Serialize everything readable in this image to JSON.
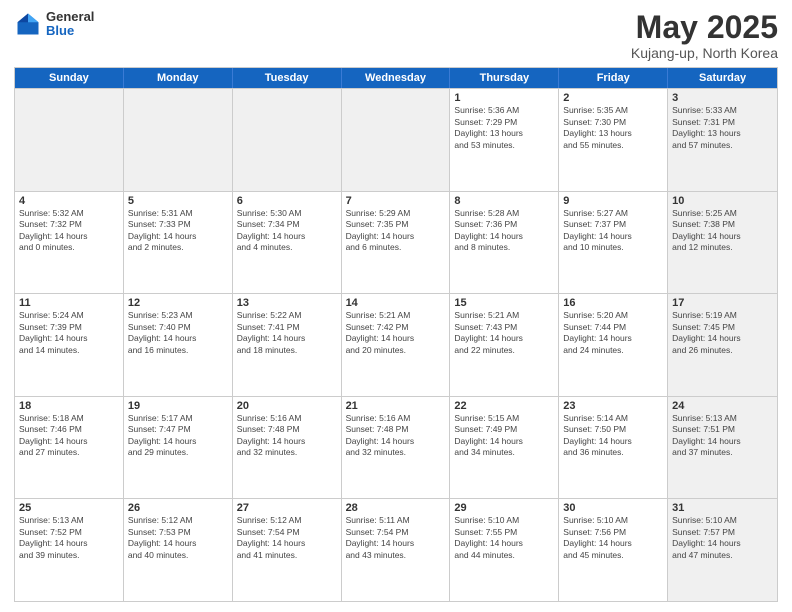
{
  "logo": {
    "general": "General",
    "blue": "Blue"
  },
  "title": "May 2025",
  "subtitle": "Kujang-up, North Korea",
  "days": [
    "Sunday",
    "Monday",
    "Tuesday",
    "Wednesday",
    "Thursday",
    "Friday",
    "Saturday"
  ],
  "rows": [
    [
      {
        "day": "",
        "sunrise": "",
        "sunset": "",
        "daylight": "",
        "shaded": true
      },
      {
        "day": "",
        "sunrise": "",
        "sunset": "",
        "daylight": "",
        "shaded": true
      },
      {
        "day": "",
        "sunrise": "",
        "sunset": "",
        "daylight": "",
        "shaded": true
      },
      {
        "day": "",
        "sunrise": "",
        "sunset": "",
        "daylight": "",
        "shaded": true
      },
      {
        "day": "1",
        "sunrise": "Sunrise: 5:36 AM",
        "sunset": "Sunset: 7:29 PM",
        "daylight": "Daylight: 13 hours",
        "daylight2": "and 53 minutes."
      },
      {
        "day": "2",
        "sunrise": "Sunrise: 5:35 AM",
        "sunset": "Sunset: 7:30 PM",
        "daylight": "Daylight: 13 hours",
        "daylight2": "and 55 minutes."
      },
      {
        "day": "3",
        "sunrise": "Sunrise: 5:33 AM",
        "sunset": "Sunset: 7:31 PM",
        "daylight": "Daylight: 13 hours",
        "daylight2": "and 57 minutes.",
        "shaded": true
      }
    ],
    [
      {
        "day": "4",
        "sunrise": "Sunrise: 5:32 AM",
        "sunset": "Sunset: 7:32 PM",
        "daylight": "Daylight: 14 hours",
        "daylight2": "and 0 minutes."
      },
      {
        "day": "5",
        "sunrise": "Sunrise: 5:31 AM",
        "sunset": "Sunset: 7:33 PM",
        "daylight": "Daylight: 14 hours",
        "daylight2": "and 2 minutes."
      },
      {
        "day": "6",
        "sunrise": "Sunrise: 5:30 AM",
        "sunset": "Sunset: 7:34 PM",
        "daylight": "Daylight: 14 hours",
        "daylight2": "and 4 minutes."
      },
      {
        "day": "7",
        "sunrise": "Sunrise: 5:29 AM",
        "sunset": "Sunset: 7:35 PM",
        "daylight": "Daylight: 14 hours",
        "daylight2": "and 6 minutes."
      },
      {
        "day": "8",
        "sunrise": "Sunrise: 5:28 AM",
        "sunset": "Sunset: 7:36 PM",
        "daylight": "Daylight: 14 hours",
        "daylight2": "and 8 minutes."
      },
      {
        "day": "9",
        "sunrise": "Sunrise: 5:27 AM",
        "sunset": "Sunset: 7:37 PM",
        "daylight": "Daylight: 14 hours",
        "daylight2": "and 10 minutes."
      },
      {
        "day": "10",
        "sunrise": "Sunrise: 5:25 AM",
        "sunset": "Sunset: 7:38 PM",
        "daylight": "Daylight: 14 hours",
        "daylight2": "and 12 minutes.",
        "shaded": true
      }
    ],
    [
      {
        "day": "11",
        "sunrise": "Sunrise: 5:24 AM",
        "sunset": "Sunset: 7:39 PM",
        "daylight": "Daylight: 14 hours",
        "daylight2": "and 14 minutes."
      },
      {
        "day": "12",
        "sunrise": "Sunrise: 5:23 AM",
        "sunset": "Sunset: 7:40 PM",
        "daylight": "Daylight: 14 hours",
        "daylight2": "and 16 minutes."
      },
      {
        "day": "13",
        "sunrise": "Sunrise: 5:22 AM",
        "sunset": "Sunset: 7:41 PM",
        "daylight": "Daylight: 14 hours",
        "daylight2": "and 18 minutes."
      },
      {
        "day": "14",
        "sunrise": "Sunrise: 5:21 AM",
        "sunset": "Sunset: 7:42 PM",
        "daylight": "Daylight: 14 hours",
        "daylight2": "and 20 minutes."
      },
      {
        "day": "15",
        "sunrise": "Sunrise: 5:21 AM",
        "sunset": "Sunset: 7:43 PM",
        "daylight": "Daylight: 14 hours",
        "daylight2": "and 22 minutes."
      },
      {
        "day": "16",
        "sunrise": "Sunrise: 5:20 AM",
        "sunset": "Sunset: 7:44 PM",
        "daylight": "Daylight: 14 hours",
        "daylight2": "and 24 minutes."
      },
      {
        "day": "17",
        "sunrise": "Sunrise: 5:19 AM",
        "sunset": "Sunset: 7:45 PM",
        "daylight": "Daylight: 14 hours",
        "daylight2": "and 26 minutes.",
        "shaded": true
      }
    ],
    [
      {
        "day": "18",
        "sunrise": "Sunrise: 5:18 AM",
        "sunset": "Sunset: 7:46 PM",
        "daylight": "Daylight: 14 hours",
        "daylight2": "and 27 minutes."
      },
      {
        "day": "19",
        "sunrise": "Sunrise: 5:17 AM",
        "sunset": "Sunset: 7:47 PM",
        "daylight": "Daylight: 14 hours",
        "daylight2": "and 29 minutes."
      },
      {
        "day": "20",
        "sunrise": "Sunrise: 5:16 AM",
        "sunset": "Sunset: 7:48 PM",
        "daylight": "Daylight: 14 hours",
        "daylight2": "and 32 minutes."
      },
      {
        "day": "21",
        "sunrise": "Sunrise: 5:16 AM",
        "sunset": "Sunset: 7:48 PM",
        "daylight": "Daylight: 14 hours",
        "daylight2": "and 32 minutes."
      },
      {
        "day": "22",
        "sunrise": "Sunrise: 5:15 AM",
        "sunset": "Sunset: 7:49 PM",
        "daylight": "Daylight: 14 hours",
        "daylight2": "and 34 minutes."
      },
      {
        "day": "23",
        "sunrise": "Sunrise: 5:14 AM",
        "sunset": "Sunset: 7:50 PM",
        "daylight": "Daylight: 14 hours",
        "daylight2": "and 36 minutes."
      },
      {
        "day": "24",
        "sunrise": "Sunrise: 5:13 AM",
        "sunset": "Sunset: 7:51 PM",
        "daylight": "Daylight: 14 hours",
        "daylight2": "and 37 minutes.",
        "shaded": true
      }
    ],
    [
      {
        "day": "25",
        "sunrise": "Sunrise: 5:13 AM",
        "sunset": "Sunset: 7:52 PM",
        "daylight": "Daylight: 14 hours",
        "daylight2": "and 39 minutes."
      },
      {
        "day": "26",
        "sunrise": "Sunrise: 5:12 AM",
        "sunset": "Sunset: 7:53 PM",
        "daylight": "Daylight: 14 hours",
        "daylight2": "and 40 minutes."
      },
      {
        "day": "27",
        "sunrise": "Sunrise: 5:12 AM",
        "sunset": "Sunset: 7:54 PM",
        "daylight": "Daylight: 14 hours",
        "daylight2": "and 41 minutes."
      },
      {
        "day": "28",
        "sunrise": "Sunrise: 5:11 AM",
        "sunset": "Sunset: 7:54 PM",
        "daylight": "Daylight: 14 hours",
        "daylight2": "and 43 minutes."
      },
      {
        "day": "29",
        "sunrise": "Sunrise: 5:10 AM",
        "sunset": "Sunset: 7:55 PM",
        "daylight": "Daylight: 14 hours",
        "daylight2": "and 44 minutes."
      },
      {
        "day": "30",
        "sunrise": "Sunrise: 5:10 AM",
        "sunset": "Sunset: 7:56 PM",
        "daylight": "Daylight: 14 hours",
        "daylight2": "and 45 minutes."
      },
      {
        "day": "31",
        "sunrise": "Sunrise: 5:10 AM",
        "sunset": "Sunset: 7:57 PM",
        "daylight": "Daylight: 14 hours",
        "daylight2": "and 47 minutes.",
        "shaded": true
      }
    ]
  ]
}
